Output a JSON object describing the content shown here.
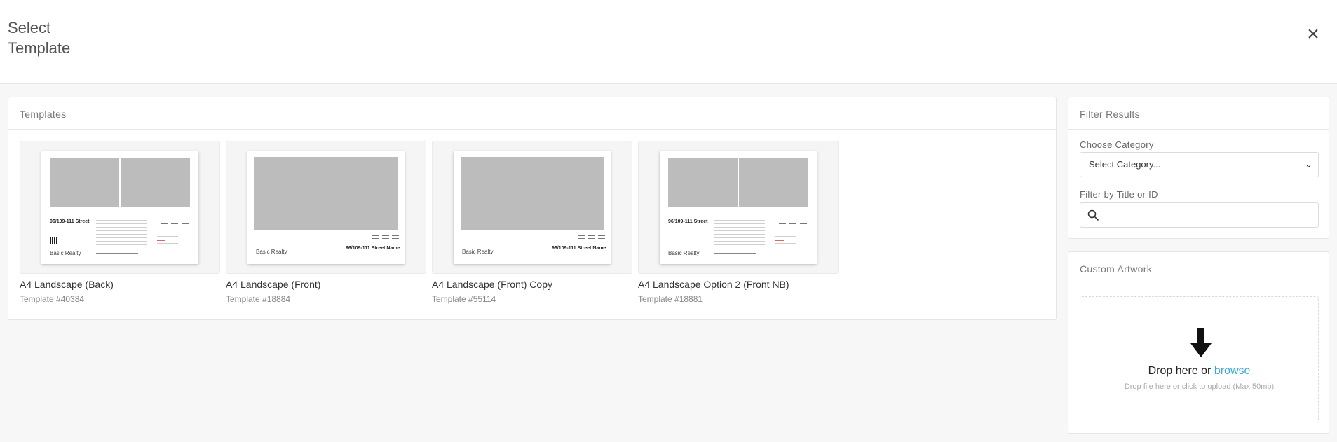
{
  "modal": {
    "title_line1": "Select",
    "title_line2": "Template",
    "close_label": "×"
  },
  "templates_panel": {
    "heading": "Templates",
    "items": [
      {
        "title": "A4 Landscape (Back)",
        "subtitle": "Template #40384",
        "preview_address": "96/109-111 Street",
        "preview_brand": "Basic Realty"
      },
      {
        "title": "A4 Landscape (Front)",
        "subtitle": "Template #18884",
        "preview_address": "96/109-111 Street Name",
        "preview_brand": "Basic Realty"
      },
      {
        "title": "A4 Landscape (Front) Copy",
        "subtitle": "Template #55114",
        "preview_address": "96/109-111 Street Name",
        "preview_brand": "Basic Realty"
      },
      {
        "title": "A4 Landscape Option 2 (Front NB)",
        "subtitle": "Template #18881",
        "preview_address": "96/109-111 Street",
        "preview_brand": "Basic Realty"
      }
    ]
  },
  "filter_panel": {
    "heading": "Filter Results",
    "category_label": "Choose Category",
    "category_selected": "Select Category...",
    "search_label": "Filter by Title or ID",
    "search_value": "",
    "search_placeholder": ""
  },
  "custom_artwork": {
    "heading": "Custom Artwork",
    "drop_text": "Drop here or",
    "browse_link": "browse",
    "drop_hint": "Drop file here or click to upload (Max 50mb)"
  },
  "colors": {
    "link": "#3aa8d8",
    "placeholder": "#bcbcbc"
  }
}
